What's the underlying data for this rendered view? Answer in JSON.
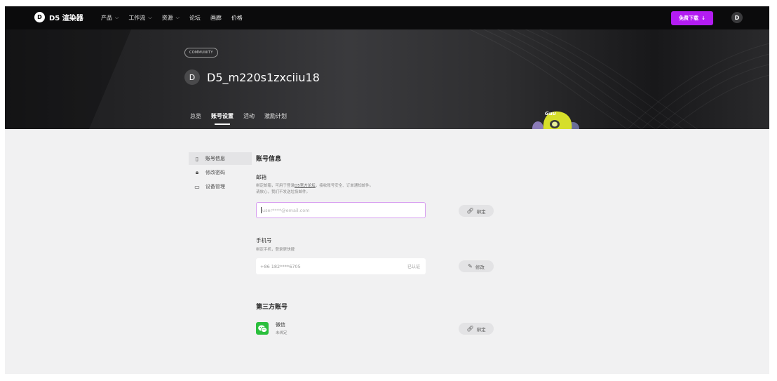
{
  "nav": {
    "logo_mark": "D",
    "logo_text": "D5 渲染器",
    "menu": [
      {
        "label": "产品",
        "dropdown": true
      },
      {
        "label": "工作流",
        "dropdown": true
      },
      {
        "label": "资源",
        "dropdown": true
      },
      {
        "label": "论坛",
        "dropdown": false
      },
      {
        "label": "画廊",
        "dropdown": false
      },
      {
        "label": "价格",
        "dropdown": false
      }
    ],
    "download_label": "免费下载",
    "download_icon": "↓",
    "avatar_initial": "D",
    "accent_color": "#b31cf2"
  },
  "hero": {
    "badge": "COMMUNITY",
    "avatar_initial": "D",
    "username": "D5_m220s1zxciiu18",
    "tabs": [
      {
        "label": "总览",
        "active": false
      },
      {
        "label": "账号设置",
        "active": true
      },
      {
        "label": "活动",
        "active": false
      },
      {
        "label": "激励计划",
        "active": false
      }
    ],
    "mascot_label": "Guu"
  },
  "sidebar": {
    "items": [
      {
        "label": "账号信息",
        "icon": "phone-icon",
        "active": true
      },
      {
        "label": "修改密码",
        "icon": "lock-icon",
        "active": false
      },
      {
        "label": "设备管理",
        "icon": "monitor-icon",
        "active": false
      }
    ]
  },
  "account": {
    "title": "账号信息",
    "email": {
      "label": "邮箱",
      "desc_prefix": "绑定邮箱，可用于登录",
      "desc_link": "D5官方论坛",
      "desc_suffix": "，接收账号安全、订单通知邮件。",
      "desc_line2": "请放心，我们不发送垃圾邮件。",
      "placeholder": "user****@email.com",
      "button_label": "绑定"
    },
    "phone": {
      "label": "手机号",
      "desc": "绑定手机，登录更快捷",
      "value": "+86  182****6705",
      "status": "已认证",
      "button_label": "修改"
    }
  },
  "third_party": {
    "title": "第三方账号",
    "wechat": {
      "name": "微信",
      "status": "未绑定",
      "button_label": "绑定",
      "color": "#2bbf3d"
    }
  }
}
